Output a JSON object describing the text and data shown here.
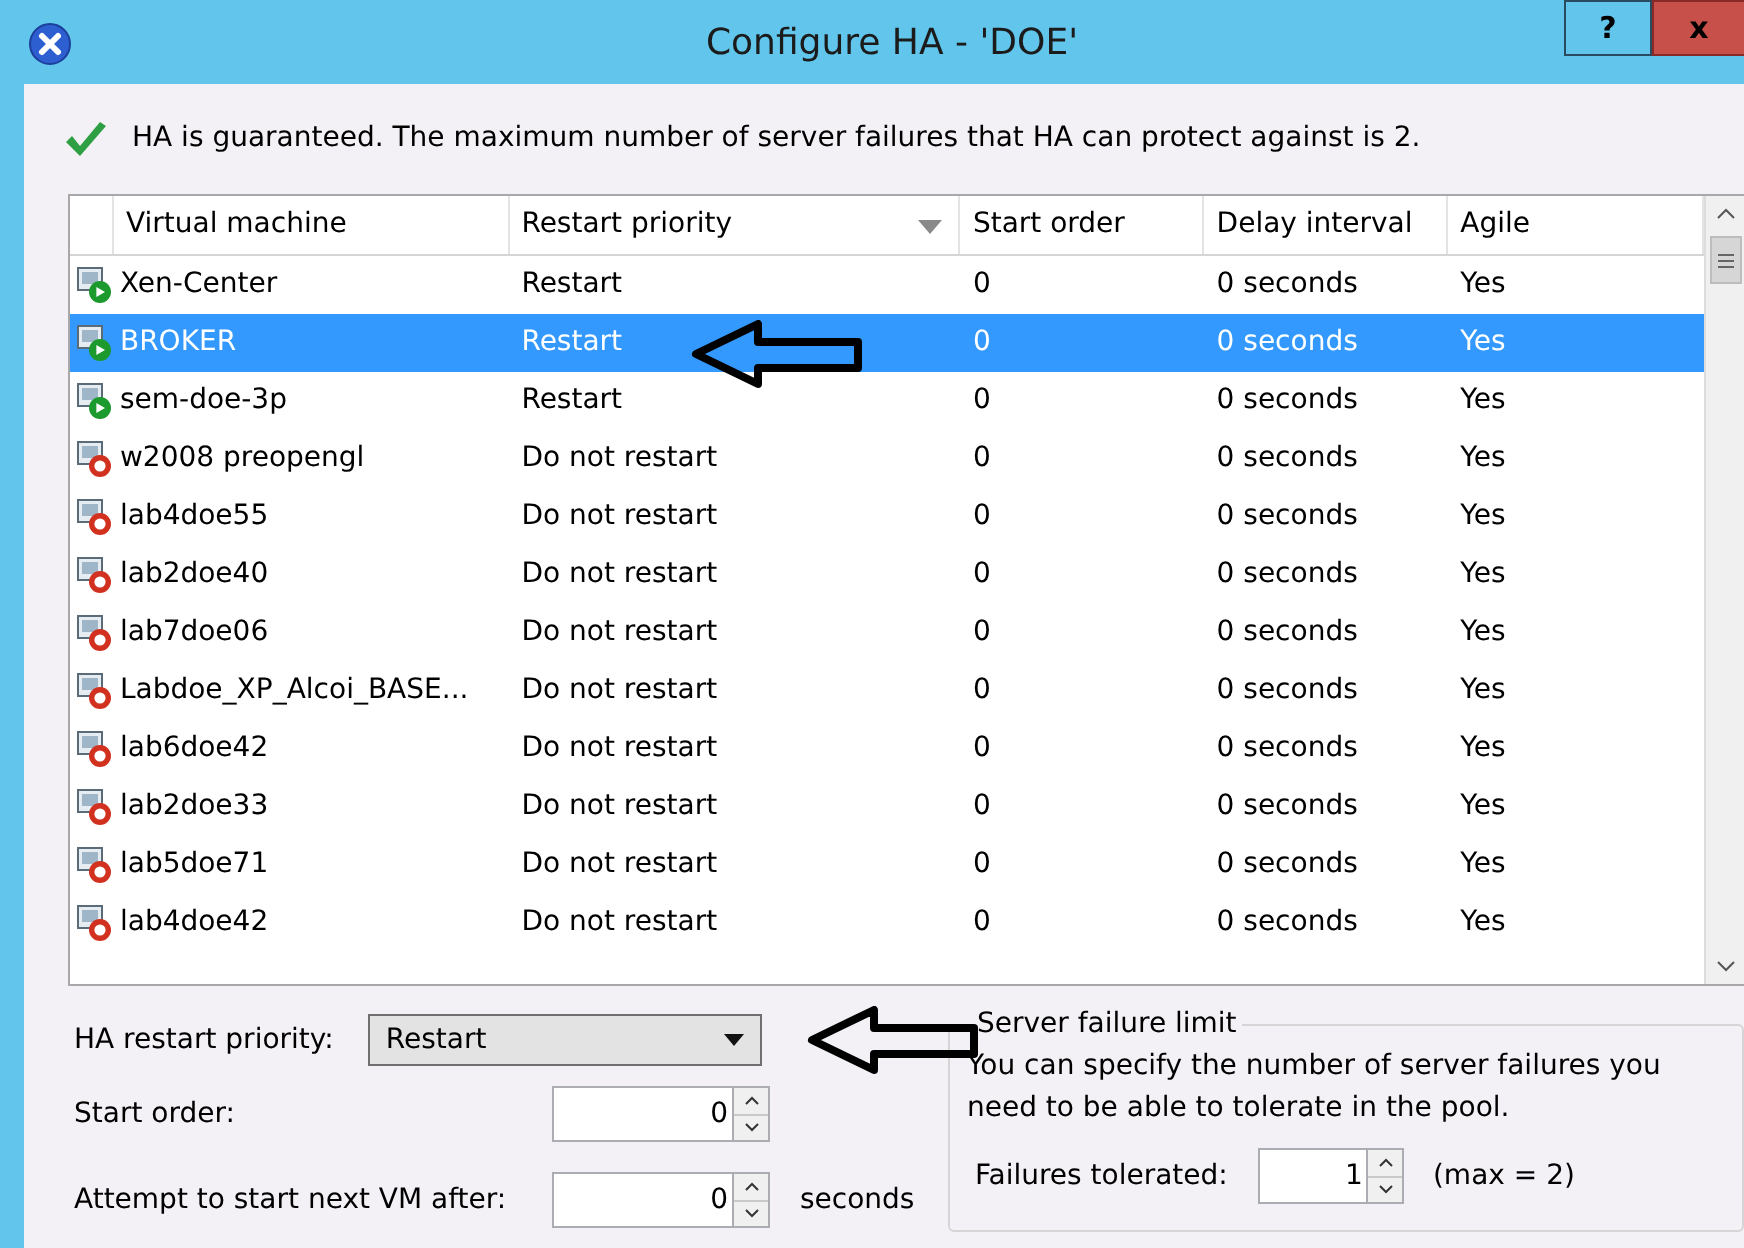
{
  "window": {
    "title": "Configure HA - 'DOE'",
    "help_button": "?",
    "close_button": "x"
  },
  "message": "HA is guaranteed. The maximum number of server failures that HA can protect against is 2.",
  "table": {
    "columns": [
      "Virtual machine",
      "Restart priority",
      "Start order",
      "Delay interval",
      "Agile"
    ],
    "rows": [
      {
        "name": "Xen-Center",
        "kind": "running",
        "priority": "Restart",
        "order": "0",
        "delay": "0 seconds",
        "agile": "Yes",
        "selected": false
      },
      {
        "name": "BROKER",
        "kind": "running",
        "priority": "Restart",
        "order": "0",
        "delay": "0 seconds",
        "agile": "Yes",
        "selected": true
      },
      {
        "name": "sem-doe-3p",
        "kind": "running",
        "priority": "Restart",
        "order": "0",
        "delay": "0 seconds",
        "agile": "Yes",
        "selected": false
      },
      {
        "name": "w2008 preopengl",
        "kind": "stopped",
        "priority": "Do not restart",
        "order": "0",
        "delay": "0 seconds",
        "agile": "Yes",
        "selected": false
      },
      {
        "name": "lab4doe55",
        "kind": "stopped",
        "priority": "Do not restart",
        "order": "0",
        "delay": "0 seconds",
        "agile": "Yes",
        "selected": false
      },
      {
        "name": "lab2doe40",
        "kind": "stopped",
        "priority": "Do not restart",
        "order": "0",
        "delay": "0 seconds",
        "agile": "Yes",
        "selected": false
      },
      {
        "name": "lab7doe06",
        "kind": "stopped",
        "priority": "Do not restart",
        "order": "0",
        "delay": "0 seconds",
        "agile": "Yes",
        "selected": false
      },
      {
        "name": "Labdoe_XP_Alcoi_BASE...",
        "kind": "stopped",
        "priority": "Do not restart",
        "order": "0",
        "delay": "0 seconds",
        "agile": "Yes",
        "selected": false
      },
      {
        "name": "lab6doe42",
        "kind": "stopped",
        "priority": "Do not restart",
        "order": "0",
        "delay": "0 seconds",
        "agile": "Yes",
        "selected": false
      },
      {
        "name": "lab2doe33",
        "kind": "stopped",
        "priority": "Do not restart",
        "order": "0",
        "delay": "0 seconds",
        "agile": "Yes",
        "selected": false
      },
      {
        "name": "lab5doe71",
        "kind": "stopped",
        "priority": "Do not restart",
        "order": "0",
        "delay": "0 seconds",
        "agile": "Yes",
        "selected": false
      },
      {
        "name": "lab4doe42",
        "kind": "stopped",
        "priority": "Do not restart",
        "order": "0",
        "delay": "0 seconds",
        "agile": "Yes",
        "selected": false
      }
    ]
  },
  "settings": {
    "priority_label": "HA restart priority:",
    "priority_value": "Restart",
    "start_order_label": "Start order:",
    "start_order_value": "0",
    "attempt_label": "Attempt to start next VM after:",
    "attempt_value": "0",
    "attempt_unit": "seconds"
  },
  "server_failure_limit": {
    "title": "Server failure limit",
    "description": "You can specify the number of server failures you need to be able to tolerate in the pool.",
    "failures_label": "Failures tolerated:",
    "failures_value": "1",
    "max_note": "(max = 2)"
  }
}
